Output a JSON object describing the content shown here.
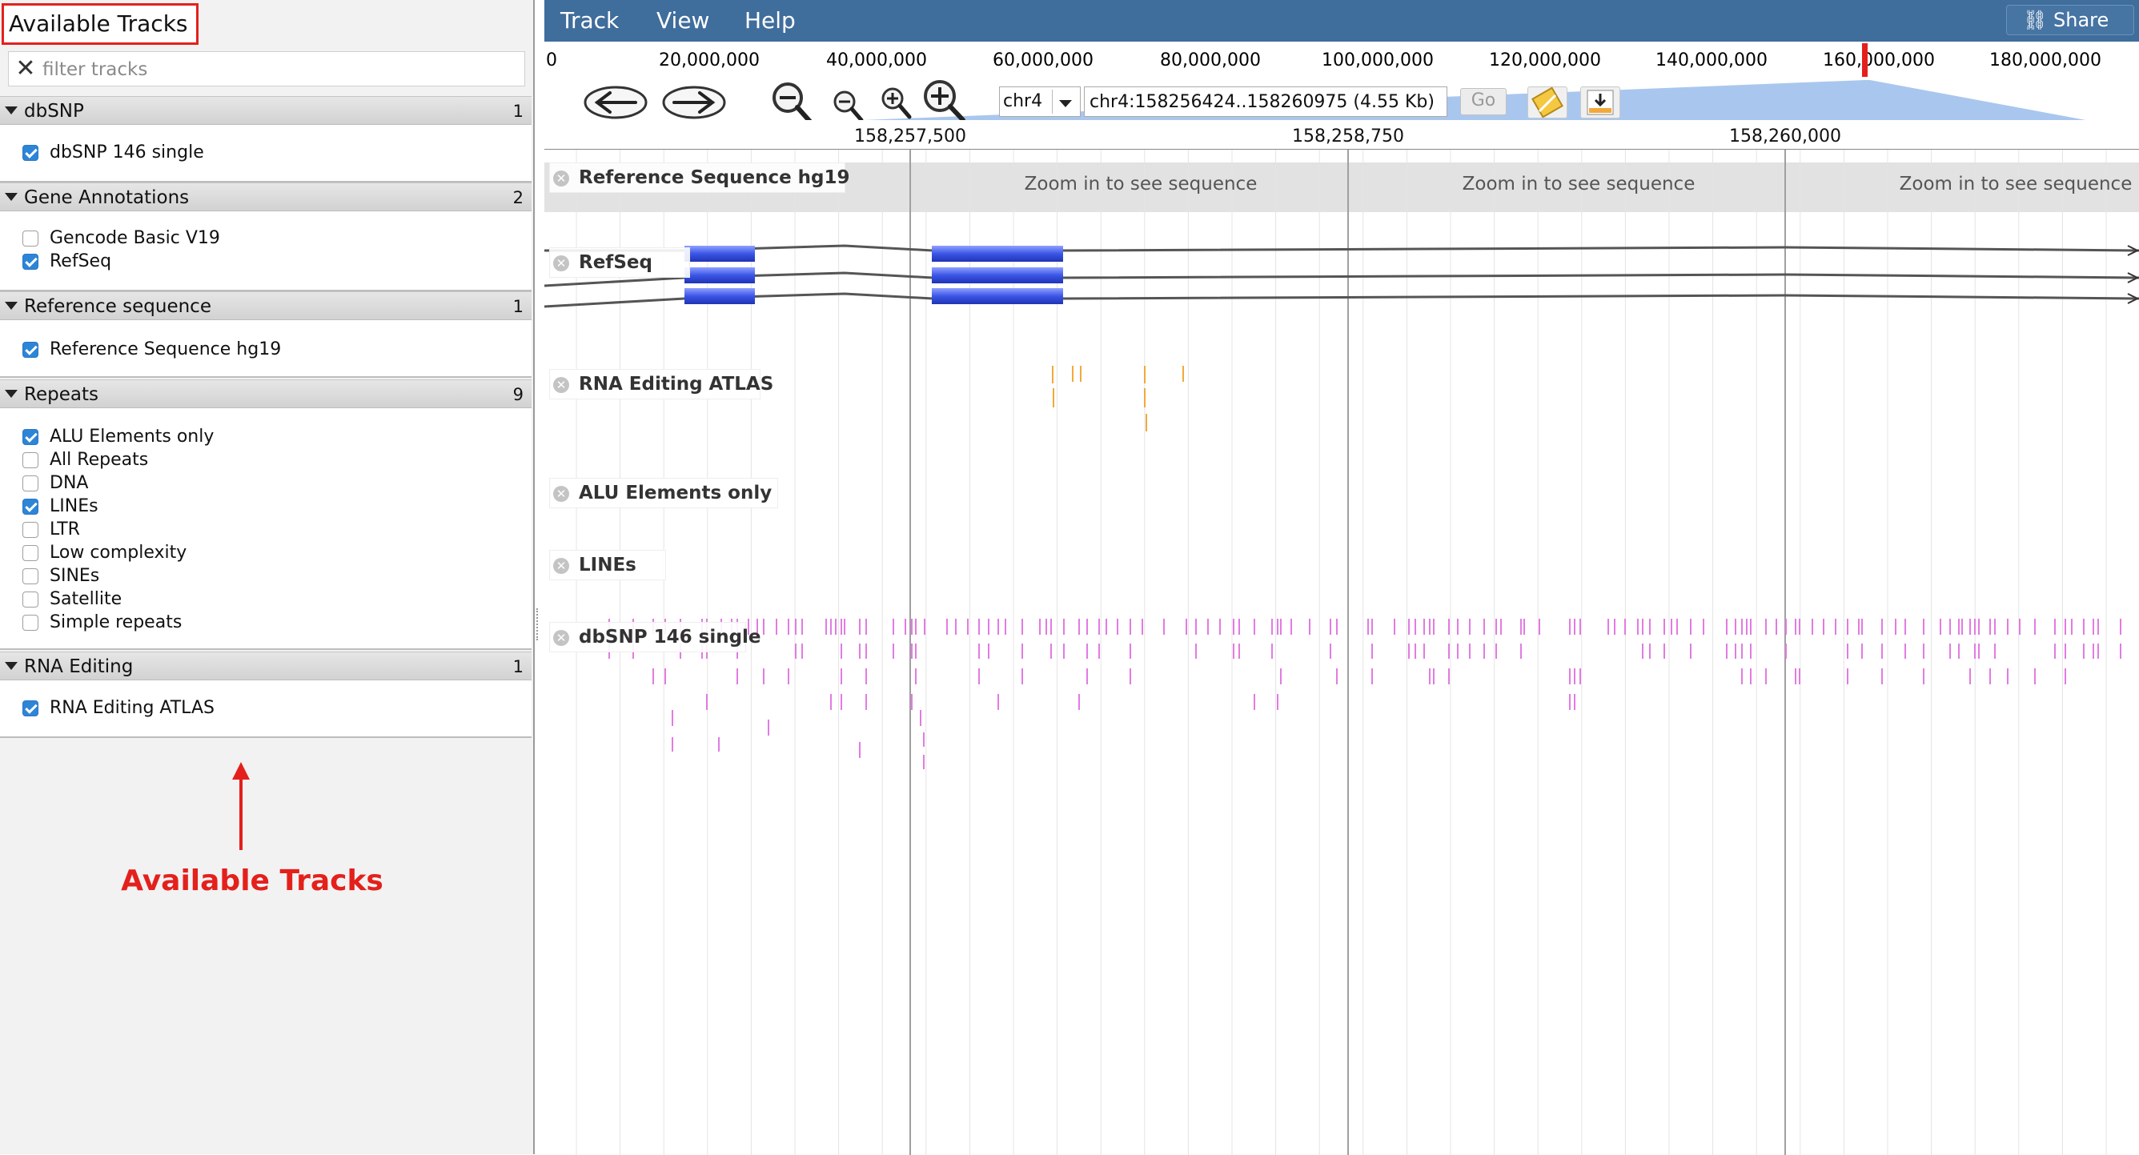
{
  "left_panel": {
    "title": "Available Tracks",
    "filter_placeholder": "filter tracks",
    "categories": [
      {
        "label": "dbSNP",
        "count": "1",
        "tracks": [
          {
            "label": "dbSNP 146 single",
            "checked": true
          }
        ]
      },
      {
        "label": "Gene Annotations",
        "count": "2",
        "tracks": [
          {
            "label": "Gencode Basic V19",
            "checked": false
          },
          {
            "label": "RefSeq",
            "checked": true
          }
        ]
      },
      {
        "label": "Reference sequence",
        "count": "1",
        "tracks": [
          {
            "label": "Reference Sequence hg19",
            "checked": true
          }
        ]
      },
      {
        "label": "Repeats",
        "count": "9",
        "tracks": [
          {
            "label": "ALU Elements only",
            "checked": true
          },
          {
            "label": "All Repeats",
            "checked": false
          },
          {
            "label": "DNA",
            "checked": false
          },
          {
            "label": "LINEs",
            "checked": true
          },
          {
            "label": "LTR",
            "checked": false
          },
          {
            "label": "Low complexity",
            "checked": false
          },
          {
            "label": "SINEs",
            "checked": false
          },
          {
            "label": "Satellite",
            "checked": false
          },
          {
            "label": "Simple repeats",
            "checked": false
          }
        ]
      },
      {
        "label": "RNA Editing",
        "count": "1",
        "tracks": [
          {
            "label": "RNA Editing ATLAS",
            "checked": true
          }
        ]
      }
    ],
    "annotation_label": "Available Tracks"
  },
  "menubar": {
    "items": [
      "Track",
      "View",
      "Help"
    ],
    "share_label": "Share"
  },
  "overview": {
    "ticks": [
      "0",
      "20,000,000",
      "40,000,000",
      "60,000,000",
      "80,000,000",
      "100,000,000",
      "120,000,000",
      "140,000,000",
      "160,000,000",
      "180,000,000"
    ]
  },
  "navigation": {
    "chromosome": "chr4",
    "locus": "chr4:158256424..158260975 (4.55 Kb)",
    "go_label": "Go"
  },
  "scale": {
    "labels": [
      "158,257,500",
      "158,258,750",
      "158,260,000"
    ]
  },
  "tracks": {
    "reference": {
      "title": "Reference Sequence hg19",
      "zoom_message": "Zoom in to see sequence"
    },
    "refseq": {
      "title": "RefSeq"
    },
    "rna_editing": {
      "title": "RNA Editing ATLAS"
    },
    "alu": {
      "title": "ALU Elements only"
    },
    "lines": {
      "title": "LINEs"
    },
    "dbsnp": {
      "title": "dbSNP 146 single"
    }
  },
  "colors": {
    "menubar": "#3f6d9c",
    "annotation_red": "#e4201c",
    "gene_blue": "#3b55e6",
    "snp_magenta": "#e27be2",
    "rna_orange": "#f2a93a",
    "checkbox_blue": "#2d85d8"
  },
  "icons": [
    "close-icon",
    "back-arrow-icon",
    "forward-arrow-icon",
    "zoom-out-large-icon",
    "zoom-out-small-icon",
    "zoom-in-small-icon",
    "zoom-in-large-icon",
    "highlight-icon",
    "export-icon",
    "link-icon"
  ]
}
